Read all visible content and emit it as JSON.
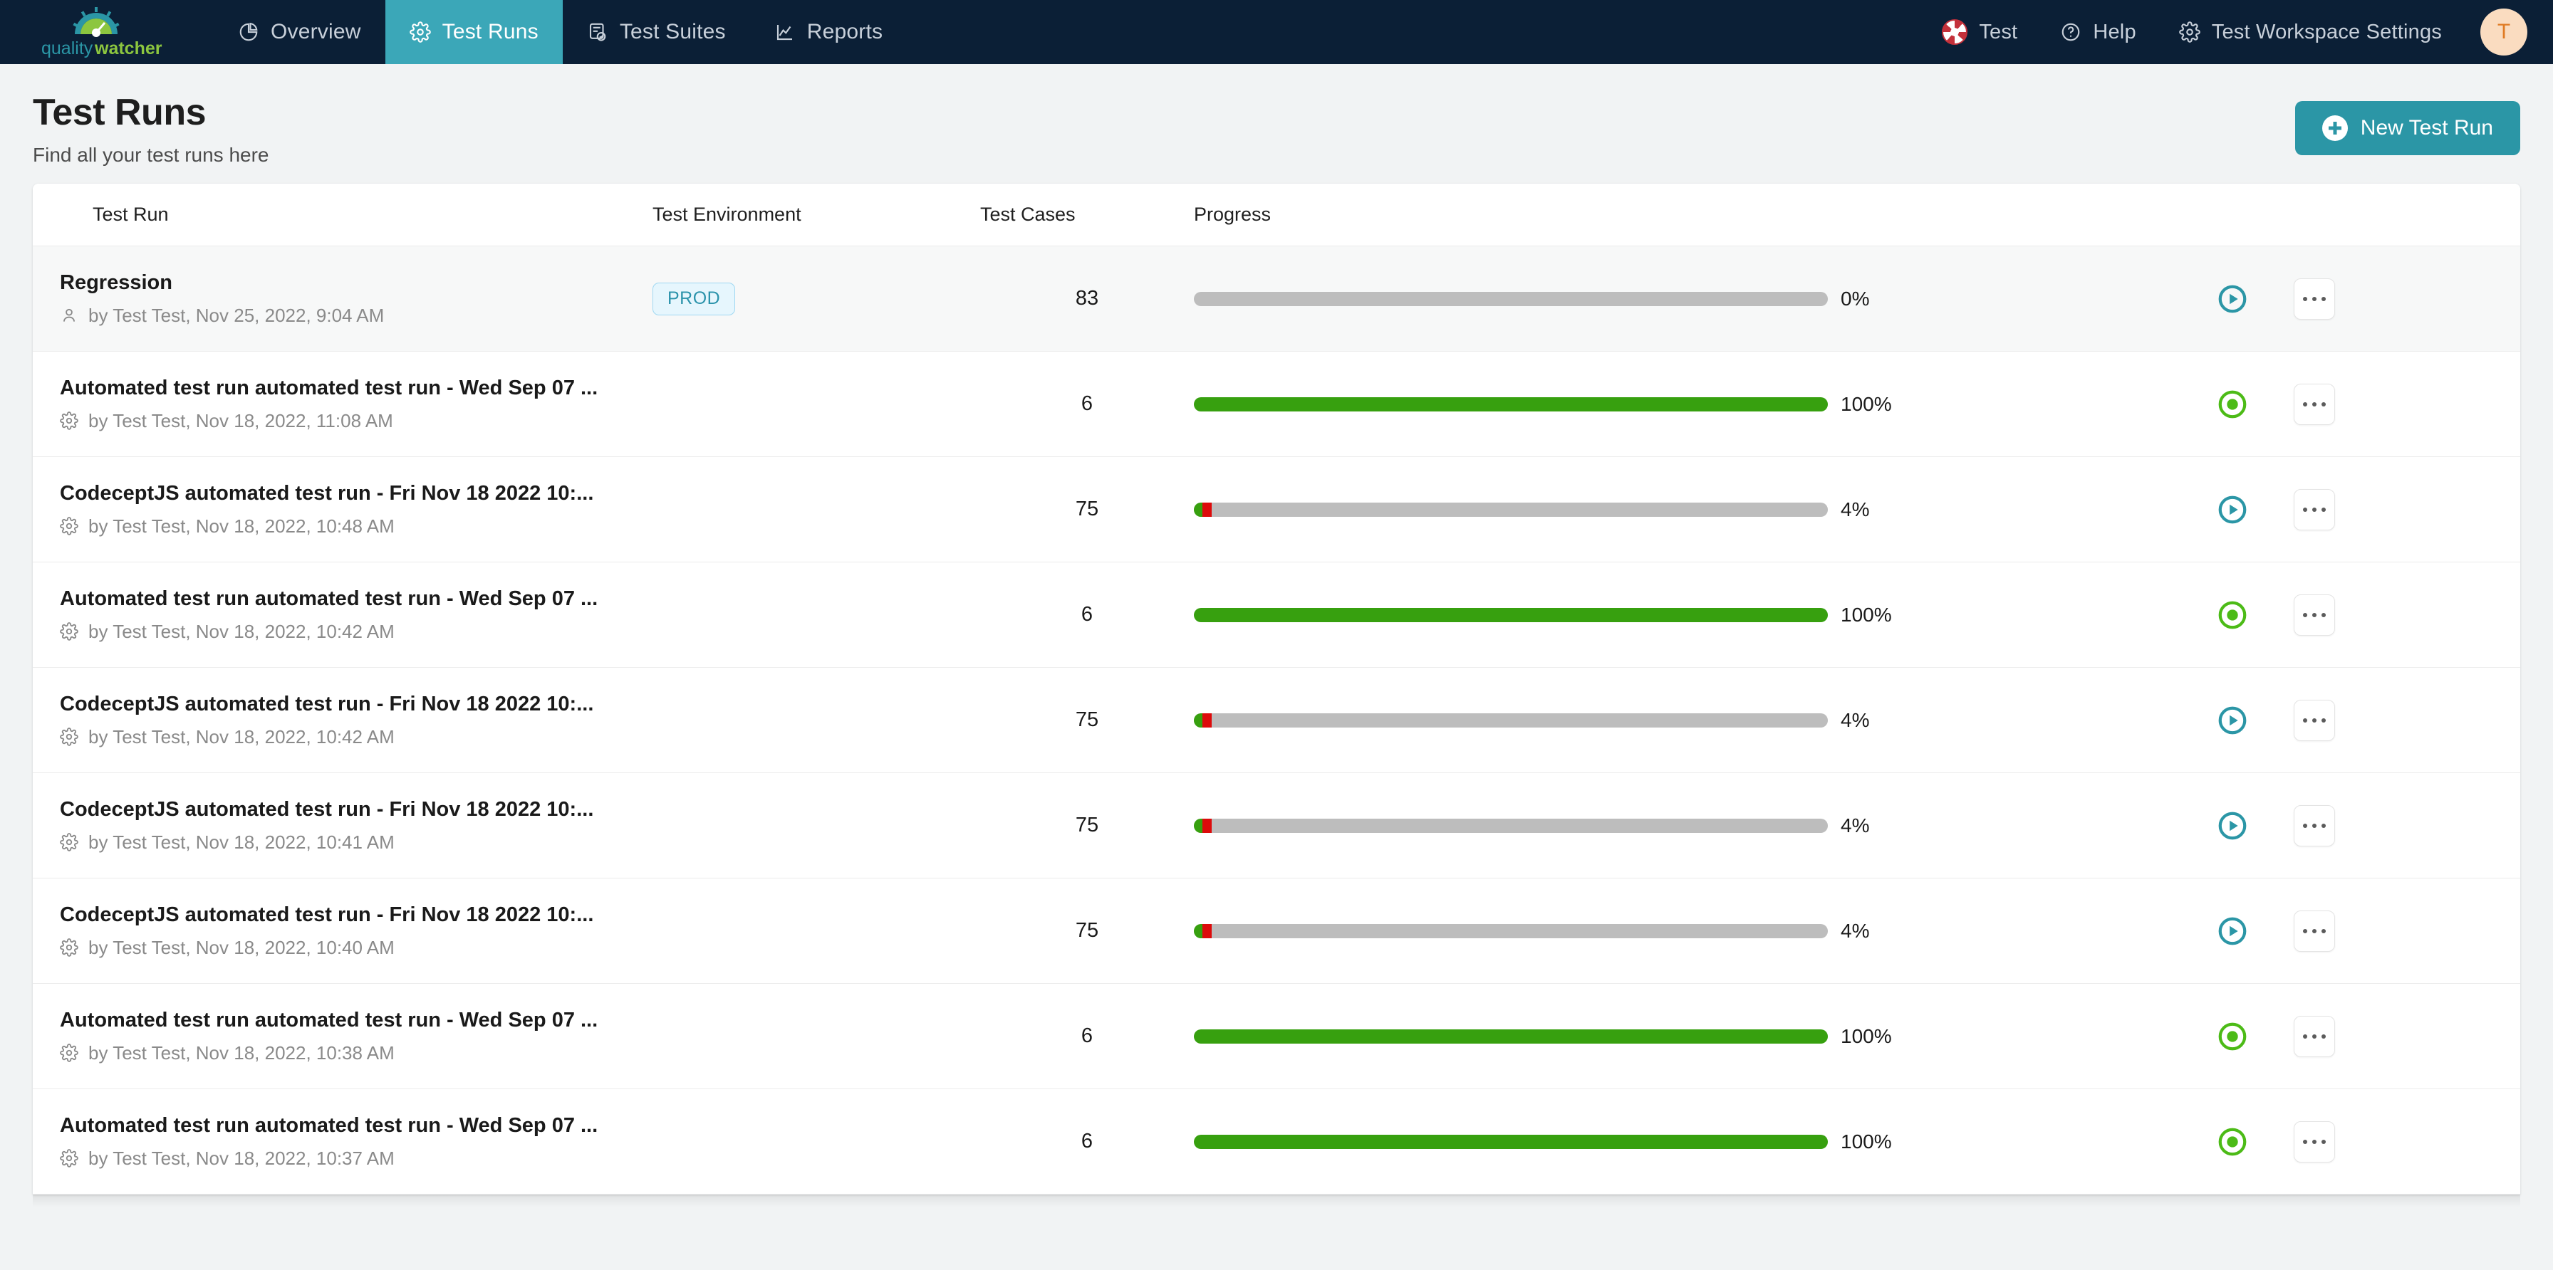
{
  "navbar": {
    "brand": "qualitywatcher",
    "brand_part1": "quality",
    "brand_part2": "watcher",
    "left_items": [
      {
        "label": "Overview",
        "icon": "pie-chart-icon",
        "active": false
      },
      {
        "label": "Test Runs",
        "icon": "gear-icon",
        "active": true
      },
      {
        "label": "Test Suites",
        "icon": "clipboard-check-icon",
        "active": false
      },
      {
        "label": "Reports",
        "icon": "line-chart-icon",
        "active": false
      }
    ],
    "right_items": [
      {
        "label": "Test",
        "icon": "project-logo-icon"
      },
      {
        "label": "Help",
        "icon": "question-circle-icon"
      },
      {
        "label": "Test Workspace Settings",
        "icon": "gear-icon"
      }
    ],
    "avatar_initial": "T",
    "active_color": "#3ba7b8",
    "background": "#0b1f36"
  },
  "header": {
    "title": "Test Runs",
    "subtitle": "Find all your test runs here",
    "new_button": "New Test Run",
    "accent_color": "#2b96a6"
  },
  "table": {
    "columns": [
      "Test Run",
      "Test Environment",
      "Test Cases",
      "Progress"
    ],
    "rows": [
      {
        "title": "Regression",
        "meta": "by Test Test, Nov 25, 2022, 9:04 AM",
        "meta_icon": "user-icon",
        "environment": "PROD",
        "cases": "83",
        "progress_label": "0%",
        "pass_pct": 0,
        "fail_pct": 0,
        "status_icon": "play-circle-icon",
        "status_color": "#2b96a6",
        "shaded": true
      },
      {
        "title": "Automated test run automated test run - Wed Sep 07 ...",
        "meta": "by Test Test, Nov 18, 2022, 11:08 AM",
        "meta_icon": "gear-icon",
        "environment": "",
        "cases": "6",
        "progress_label": "100%",
        "pass_pct": 100,
        "fail_pct": 0,
        "status_icon": "record-circle-icon",
        "status_color": "#4cbb17",
        "shaded": false
      },
      {
        "title": "CodeceptJS automated test run - Fri Nov 18 2022 10:...",
        "meta": "by Test Test, Nov 18, 2022, 10:48 AM",
        "meta_icon": "gear-icon",
        "environment": "",
        "cases": "75",
        "progress_label": "4%",
        "pass_pct": 1.4,
        "fail_pct": 1.4,
        "status_icon": "play-circle-icon",
        "status_color": "#2b96a6",
        "shaded": false
      },
      {
        "title": "Automated test run automated test run - Wed Sep 07 ...",
        "meta": "by Test Test, Nov 18, 2022, 10:42 AM",
        "meta_icon": "gear-icon",
        "environment": "",
        "cases": "6",
        "progress_label": "100%",
        "pass_pct": 100,
        "fail_pct": 0,
        "status_icon": "record-circle-icon",
        "status_color": "#4cbb17",
        "shaded": false
      },
      {
        "title": "CodeceptJS automated test run - Fri Nov 18 2022 10:...",
        "meta": "by Test Test, Nov 18, 2022, 10:42 AM",
        "meta_icon": "gear-icon",
        "environment": "",
        "cases": "75",
        "progress_label": "4%",
        "pass_pct": 1.4,
        "fail_pct": 1.4,
        "status_icon": "play-circle-icon",
        "status_color": "#2b96a6",
        "shaded": false
      },
      {
        "title": "CodeceptJS automated test run - Fri Nov 18 2022 10:...",
        "meta": "by Test Test, Nov 18, 2022, 10:41 AM",
        "meta_icon": "gear-icon",
        "environment": "",
        "cases": "75",
        "progress_label": "4%",
        "pass_pct": 1.4,
        "fail_pct": 1.4,
        "status_icon": "play-circle-icon",
        "status_color": "#2b96a6",
        "shaded": false
      },
      {
        "title": "CodeceptJS automated test run - Fri Nov 18 2022 10:...",
        "meta": "by Test Test, Nov 18, 2022, 10:40 AM",
        "meta_icon": "gear-icon",
        "environment": "",
        "cases": "75",
        "progress_label": "4%",
        "pass_pct": 1.4,
        "fail_pct": 1.4,
        "status_icon": "play-circle-icon",
        "status_color": "#2b96a6",
        "shaded": false
      },
      {
        "title": "Automated test run automated test run - Wed Sep 07 ...",
        "meta": "by Test Test, Nov 18, 2022, 10:38 AM",
        "meta_icon": "gear-icon",
        "environment": "",
        "cases": "6",
        "progress_label": "100%",
        "pass_pct": 100,
        "fail_pct": 0,
        "status_icon": "record-circle-icon",
        "status_color": "#4cbb17",
        "shaded": false
      },
      {
        "title": "Automated test run automated test run - Wed Sep 07 ...",
        "meta": "by Test Test, Nov 18, 2022, 10:37 AM",
        "meta_icon": "gear-icon",
        "environment": "",
        "cases": "6",
        "progress_label": "100%",
        "pass_pct": 100,
        "fail_pct": 0,
        "status_icon": "record-circle-icon",
        "status_color": "#4cbb17",
        "shaded": false
      }
    ]
  }
}
